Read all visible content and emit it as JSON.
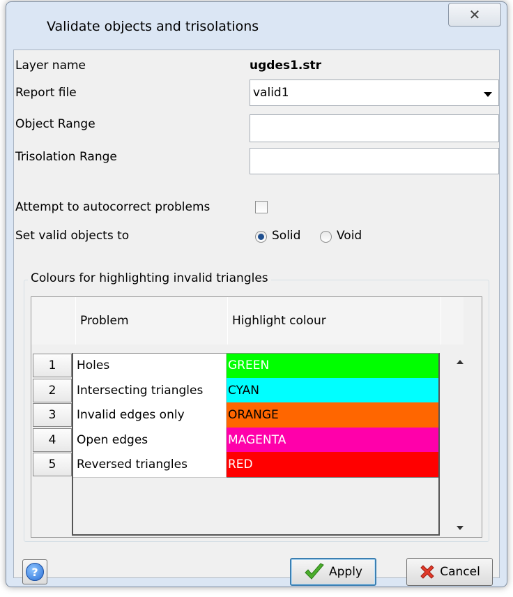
{
  "window": {
    "title": "Validate objects and trisolations",
    "close_glyph": "✕"
  },
  "form": {
    "layer_name_label": "Layer name",
    "layer_name_value": "ugdes1.str",
    "report_file_label": "Report file",
    "report_file_value": "valid1",
    "object_range_label": "Object Range",
    "object_range_value": "",
    "trisolation_range_label": "Trisolation Range",
    "trisolation_range_value": "",
    "autocorrect_label": "Attempt to autocorrect problems",
    "autocorrect_checked": false,
    "set_valid_label": "Set valid objects to",
    "radio_solid": "Solid",
    "radio_void": "Void",
    "selected": "Solid"
  },
  "group": {
    "title": "Colours for highlighting invalid triangles",
    "columns": [
      "Problem",
      "Highlight colour"
    ],
    "rows": [
      {
        "num": "1",
        "problem": "Holes",
        "colour": "GREEN",
        "bg": "#00ff00",
        "fg": "#ffffff"
      },
      {
        "num": "2",
        "problem": "Intersecting triangles",
        "colour": "CYAN",
        "bg": "#00ffff",
        "fg": "#000000"
      },
      {
        "num": "3",
        "problem": "Invalid edges only",
        "colour": "ORANGE",
        "bg": "#ff6600",
        "fg": "#000000"
      },
      {
        "num": "4",
        "problem": "Open edges",
        "colour": "MAGENTA",
        "bg": "#ff00aa",
        "fg": "#ffffff"
      },
      {
        "num": "5",
        "problem": "Reversed triangles",
        "colour": "RED",
        "bg": "#ff0000",
        "fg": "#ffffff"
      }
    ]
  },
  "buttons": {
    "help": "?",
    "apply": "Apply",
    "cancel": "Cancel"
  },
  "icons": {
    "help": "help-icon",
    "apply": "checkmark-icon",
    "cancel": "cross-icon",
    "dropdown": "chevron-down-icon"
  }
}
